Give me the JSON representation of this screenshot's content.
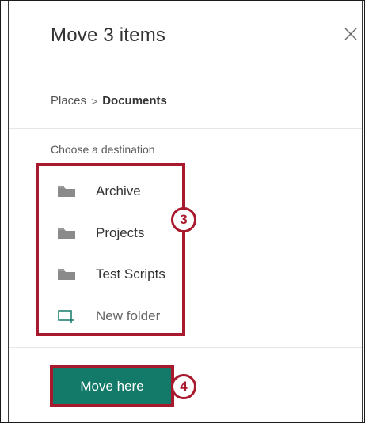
{
  "panel": {
    "title": "Move 3 items",
    "close_icon": "close-icon"
  },
  "breadcrumb": {
    "root": "Places",
    "separator": ">",
    "current": "Documents"
  },
  "destination": {
    "label": "Choose a destination",
    "folders": [
      {
        "label": "Archive",
        "icon": "folder-icon"
      },
      {
        "label": "Projects",
        "icon": "folder-icon"
      },
      {
        "label": "Test Scripts",
        "icon": "folder-icon"
      }
    ],
    "new_folder": {
      "label": "New folder",
      "icon": "new-folder-icon"
    }
  },
  "action": {
    "move_label": "Move here"
  },
  "callouts": {
    "step_folders": "3",
    "step_button": "4"
  },
  "colors": {
    "accent": "#137a6a",
    "highlight": "#a8192e",
    "folder_icon": "#8a8a8a"
  }
}
